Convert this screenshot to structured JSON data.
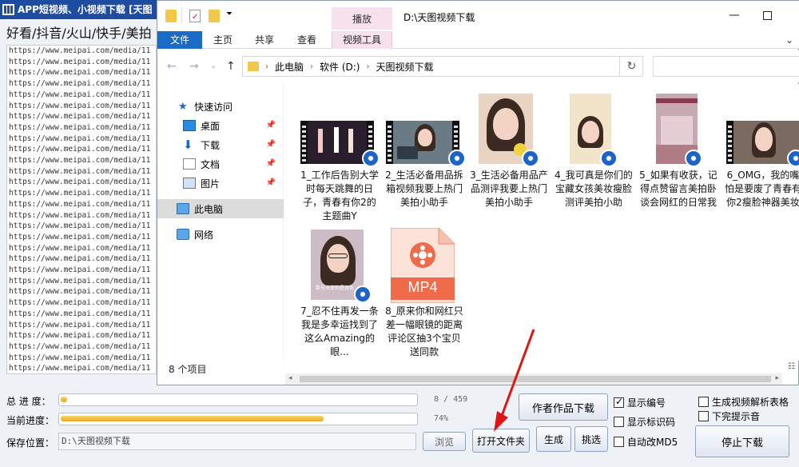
{
  "app": {
    "title": "APP短视频、小视频下载 [天图",
    "platforms": "好看/抖音/火山/快手/美拍",
    "url_lines": [
      "https://www.meipai.com/media/11",
      "https://www.meipai.com/media/11",
      "https://www.meipai.com/media/11",
      "https://www.meipai.com/media/11",
      "https://www.meipai.com/media/11",
      "https://www.meipai.com/media/11",
      "https://www.meipai.com/media/11",
      "https://www.meipai.com/media/11",
      "https://www.meipai.com/media/11",
      "https://www.meipai.com/media/11",
      "https://www.meipai.com/media/11",
      "https://www.meipai.com/media/11",
      "https://www.meipai.com/media/11",
      "https://www.meipai.com/media/11",
      "https://www.meipai.com/media/11",
      "https://www.meipai.com/media/11",
      "https://www.meipai.com/media/11",
      "https://www.meipai.com/media/11",
      "https://www.meipai.com/media/11",
      "https://www.meipai.com/media/11",
      "https://www.meipai.com/media/11",
      "https://www.meipai.com/media/11",
      "https://www.meipai.com/media/11",
      "https://www.meipai.com/media/11",
      "https://www.meipai.com/media/11",
      "https://www.meipai.com/media/11",
      "https://www.meipai.com/media/11",
      "https://www.meipai.com/media/11",
      "https://www.meipai.com/media/11",
      "https://www.meipai.com/media/11"
    ],
    "total_progress_label": "总 进 度：",
    "total_progress_text": "8 / 459",
    "total_progress_fraction": 0.017,
    "current_progress_label": "当前进度：",
    "current_progress_text": "74%",
    "current_progress_percent": 74,
    "save_label": "保存位置：",
    "save_path": "D:\\天图视频下载",
    "browse_label": "浏览",
    "open_folder_label": "打开文件夹",
    "generate_label": "生成",
    "pick_label": "挑选",
    "author_works_label": "作者作品下载",
    "stop_label": "停止下载",
    "show_number_label": "显示编号",
    "show_number_checked": true,
    "show_watermark_label": "显示标识码",
    "show_watermark_checked": false,
    "auto_md5_label": "自动改MD5",
    "auto_md5_checked": false,
    "gen_table_label": "生成视频解析表格",
    "gen_table_checked": false,
    "done_sound_label": "下完提示音",
    "done_sound_checked": false
  },
  "explorer": {
    "context_tab": "播放",
    "title_path": "D:\\天图视频下载",
    "ribbon_tabs": [
      "文件",
      "主页",
      "共享",
      "查看",
      "视频工具"
    ],
    "breadcrumb": [
      "此电脑",
      "软件 (D:)",
      "天图视频下载"
    ],
    "nav": {
      "quick_access": "快速访问",
      "desktop": "桌面",
      "downloads": "下载",
      "documents": "文档",
      "pictures": "图片",
      "this_pc": "此电脑",
      "network": "网络"
    },
    "files": [
      "1_工作后告别大学时每天跳舞的日子，青春有你2的主题曲Y",
      "2_生活必备用品拆箱视频我要上热门美拍小助手",
      "3_生活必备用品产品测评我要上热门美拍小助手",
      "4_我可真是你们的宝藏女孩美妆瘦脸测评美拍小助",
      "5_如果有收获，记得点赞留言美拍卧谈会网红的日常我",
      "6_OMG，我的嘴怕是要废了青春有你2瘦脸神器美妆",
      "7_忍不住再发一条我是多幸运找到了这么Amazing的眼...",
      "8_原来你和网红只差一幅眼镜的距离评论区抽3个宝贝送同款"
    ],
    "mp4_label": "MP4",
    "item_count": "8 个项目",
    "thumb_caption": "数号天菲的是双色"
  }
}
